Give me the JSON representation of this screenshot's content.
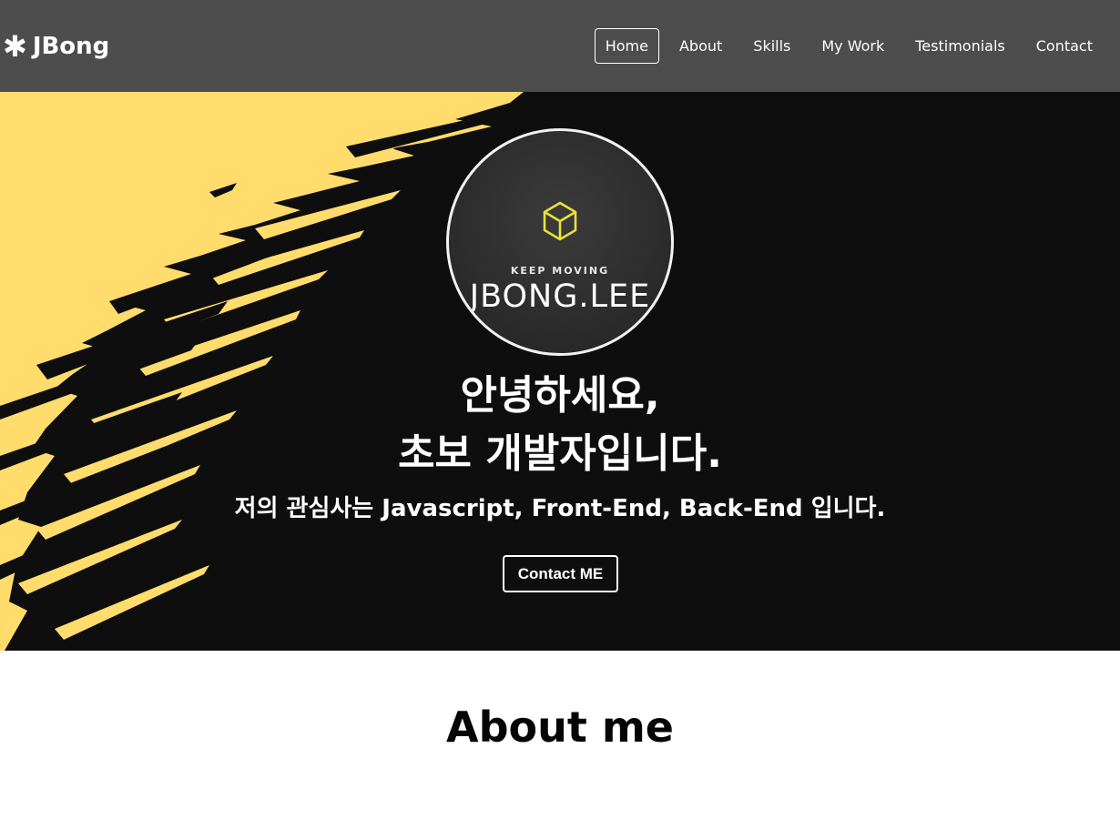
{
  "navbar": {
    "logo_icon": "✱",
    "logo_text": "JBong",
    "items": [
      {
        "label": "Home",
        "active": true
      },
      {
        "label": "About"
      },
      {
        "label": "Skills"
      },
      {
        "label": "My Work"
      },
      {
        "label": "Testimonials"
      },
      {
        "label": "Contact"
      }
    ]
  },
  "hero": {
    "profile": {
      "tagline": "KEEP MOVING",
      "name": "JBONG.LEE",
      "icon": "cube-icon"
    },
    "title_line1": "안녕하세요,",
    "title_line2": "초보 개발자입니다.",
    "subtitle": "저의 관심사는 Javascript, Front-End, Back-End 입니다.",
    "button_label": "Contact ME"
  },
  "about": {
    "title": "About me"
  },
  "colors": {
    "nav_bg": "#4d4d4d",
    "hero_bg": "#0e0e0e",
    "brush_yellow": "#ffdc6b",
    "cube_yellow": "#e8e23a",
    "text_white": "#ffffff"
  }
}
